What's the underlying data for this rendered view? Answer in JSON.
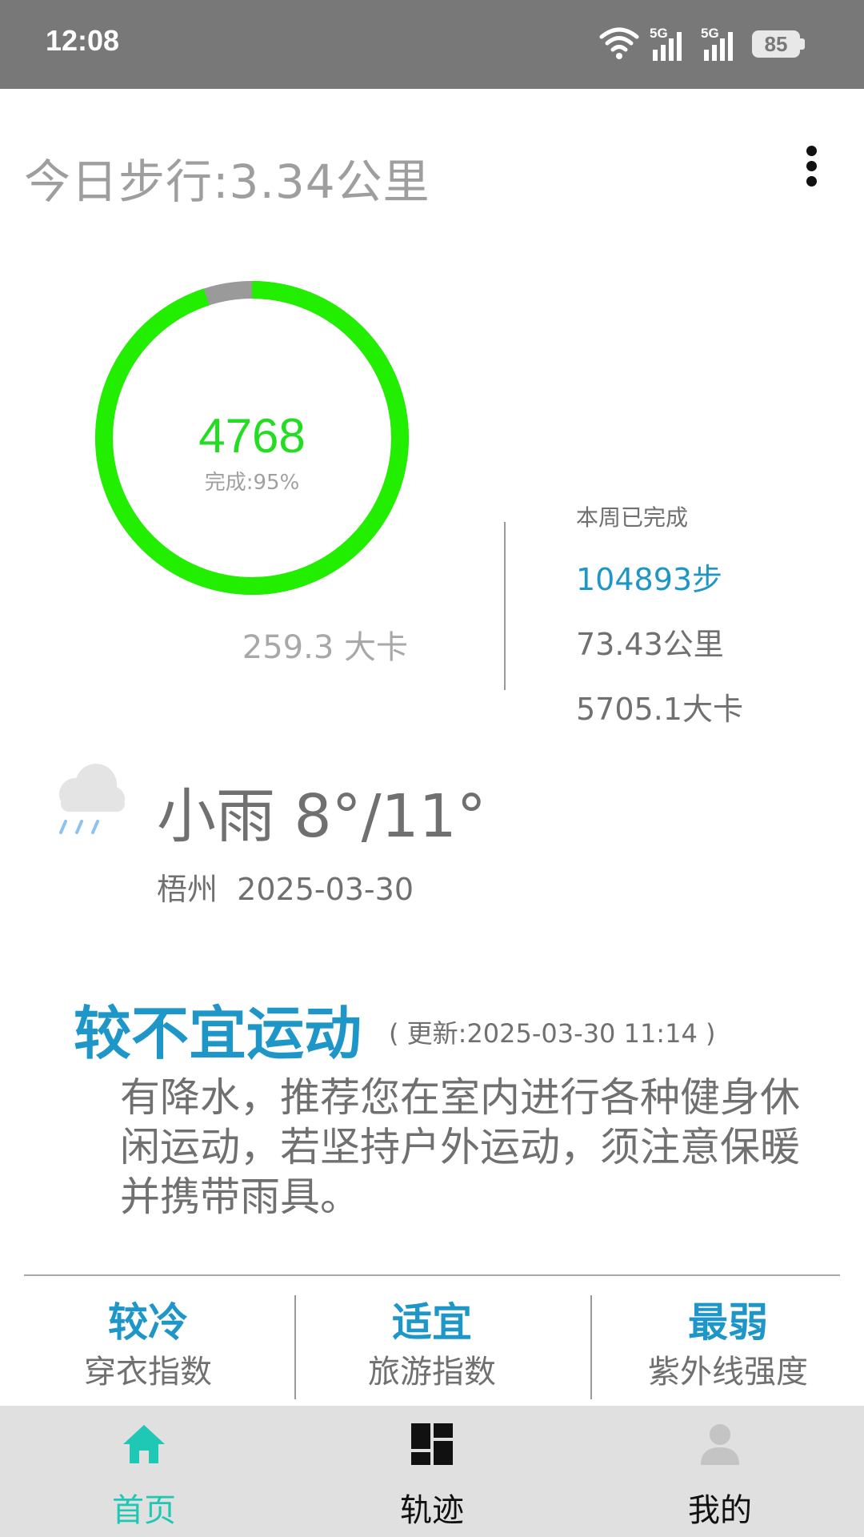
{
  "status_bar": {
    "time": "12:08",
    "signal1_label": "5G",
    "signal2_label": "5G",
    "battery": "85"
  },
  "header": {
    "title": "今日步行:3.34公里",
    "menu_icon": "more-vertical-icon"
  },
  "today": {
    "steps": "4768",
    "completion": "完成:95%",
    "completion_value": 0.95,
    "calories": "259.3 大卡",
    "ring_color": "#22ee00",
    "ring_rest_color": "#9a9a9a"
  },
  "week": {
    "label": "本周已完成",
    "steps": "104893步",
    "distance": "73.43公里",
    "calories": "5705.1大卡"
  },
  "weather": {
    "icon": "rain-cloud-icon",
    "condition_temp": "小雨 8°/11°",
    "location_date": "梧州  2025-03-30"
  },
  "advice": {
    "title": "较不宜运动",
    "updated": "( 更新:2025-03-30 11:14 )",
    "body": "有降水，推荐您在室内进行各种健身休闲运动，若坚持户外运动，须注意保暖并携带雨具。"
  },
  "indices": [
    {
      "value": "较冷",
      "label": "穿衣指数"
    },
    {
      "value": "适宜",
      "label": "旅游指数"
    },
    {
      "value": "最弱",
      "label": "紫外线强度"
    }
  ],
  "nav": [
    {
      "label": "首页",
      "icon": "home-icon",
      "active": true
    },
    {
      "label": "轨迹",
      "icon": "dashboard-grid-icon",
      "active": false
    },
    {
      "label": "我的",
      "icon": "user-profile-icon",
      "active": false
    }
  ],
  "colors": {
    "accent": "#1e96c8",
    "nav_active": "#1ec8b4",
    "step_green": "#22ee00"
  }
}
